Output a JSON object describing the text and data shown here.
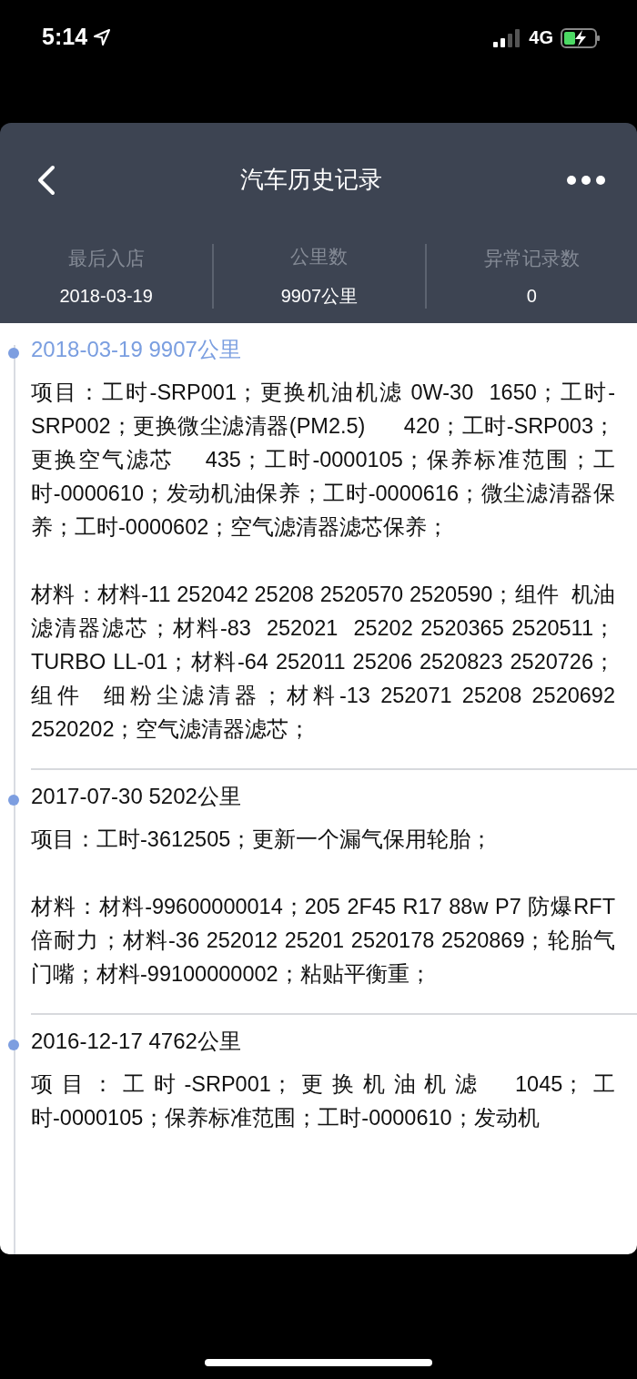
{
  "status_bar": {
    "time": "5:14",
    "network": "4G"
  },
  "header": {
    "title": "汽车历史记录"
  },
  "stats": [
    {
      "label": "最后入店",
      "value": "2018-03-19"
    },
    {
      "label": "公里数",
      "value": "9907公里"
    },
    {
      "label": "异常记录数",
      "value": "0"
    }
  ],
  "records": [
    {
      "title": "2018-03-19 9907公里",
      "selected": true,
      "paragraphs": [
        "项目：工时-SRP001；更换机油机滤 0W-30  1650；工时-SRP002；更换微尘滤清器(PM2.5)      420；工时-SRP003；更换空气滤芯    435；工时-0000105；保养标准范围；工时-0000610；发动机油保养；工时-0000616；微尘滤清器保养；工时-0000602；空气滤清器滤芯保养；",
        "材料：材料-11 252042 25208 2520570 2520590；组件  机油滤清器滤芯；材料-83  252021  25202 2520365 2520511；TURBO LL-01；材料-64 252011 25206 2520823 2520726；组件  细粉尘滤清器；材料-13 252071 25208 2520692 2520202；空气滤清器滤芯；"
      ]
    },
    {
      "title": "2017-07-30 5202公里",
      "selected": false,
      "paragraphs": [
        "项目：工时-3612505；更新一个漏气保用轮胎；",
        "材料：材料-99600000014；205 2F45 R17 88w P7 防爆RFT  倍耐力；材料-36 252012 25201 2520178 2520869；轮胎气门嘴；材料-99100000002；粘贴平衡重；"
      ]
    },
    {
      "title": "2016-12-17 4762公里",
      "selected": false,
      "paragraphs": [
        "项目：工时-SRP001；更换机油机滤  1045；工时-0000105；保养标准范围；工时-0000610；发动机"
      ]
    }
  ]
}
